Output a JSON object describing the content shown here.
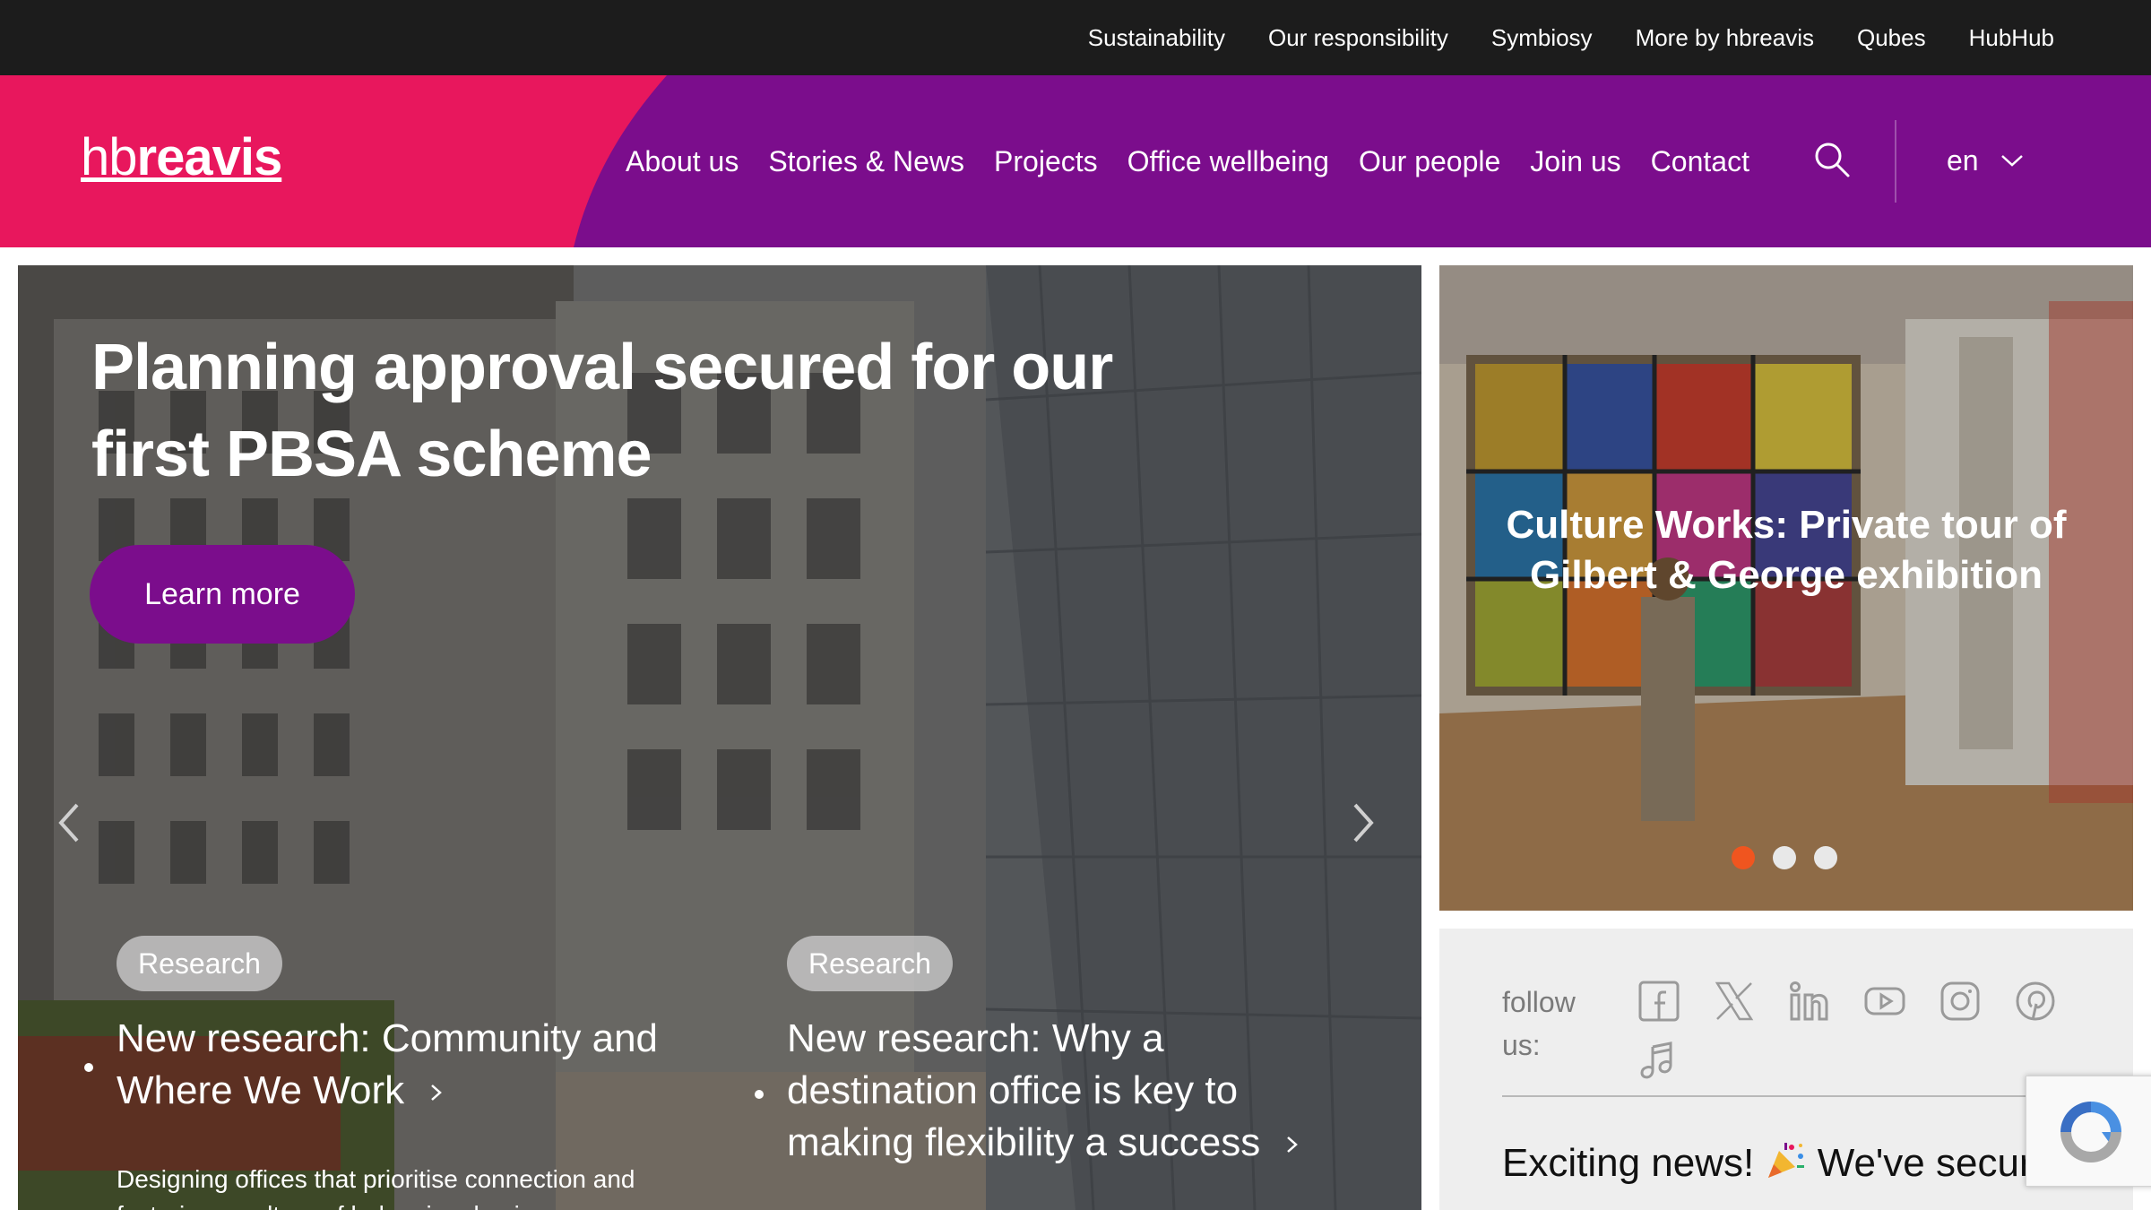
{
  "topbar": {
    "links": [
      "Sustainability",
      "Our responsibility",
      "Symbiosy",
      "More by hbreavis",
      "Qubes",
      "HubHub"
    ]
  },
  "header": {
    "logo_light": "hb",
    "logo_bold": "reavis",
    "nav": [
      "About us",
      "Stories & News",
      "Projects",
      "Office wellbeing",
      "Our people",
      "Join us",
      "Contact"
    ],
    "language": "en",
    "colors": {
      "pink": "#e8175d",
      "purple": "#7b0d8c"
    }
  },
  "hero": {
    "title": "Planning approval secured for our first PBSA scheme",
    "button": "Learn more",
    "cards": [
      {
        "badge": "Research",
        "title": "New research: Community and Where We Work",
        "description": "Designing offices that prioritise connection and fostering a culture of belonging, businesses can"
      },
      {
        "badge": "Research",
        "title": "New research: Why a destination office is key to making flexibility a success"
      }
    ]
  },
  "side": {
    "title": "Culture Works: Private tour of Gilbert & George exhibition",
    "active_slide": 1,
    "slide_count": 3,
    "colors": {
      "active_dot": "#f0551f"
    }
  },
  "follow": {
    "label": "follow us:",
    "socials": [
      "facebook-icon",
      "x-icon",
      "linkedin-icon",
      "youtube-icon",
      "instagram-icon",
      "pinterest-icon",
      "tiktok-icon"
    ],
    "news_start": "Exciting news!",
    "news_end": "We've secured"
  }
}
